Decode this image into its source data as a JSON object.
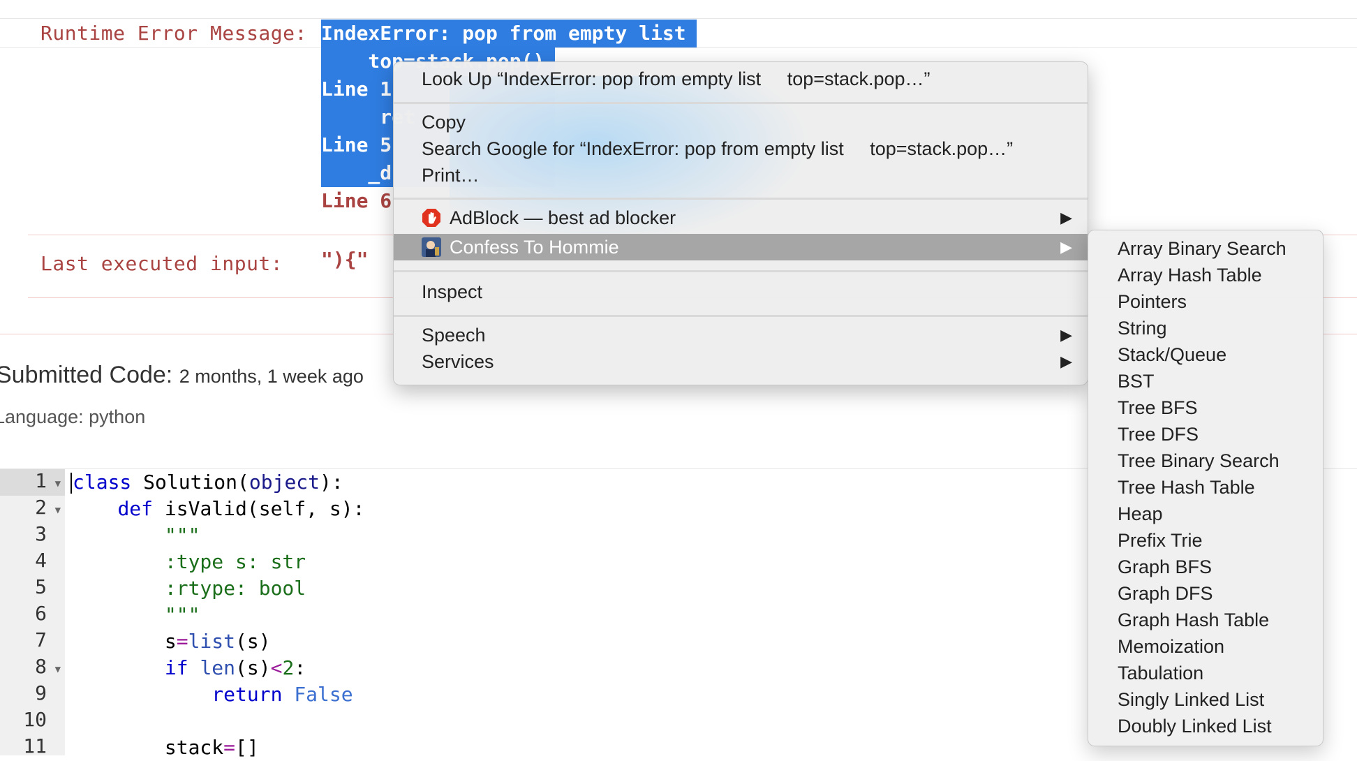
{
  "error": {
    "runtime_label": "Runtime Error Message:",
    "lines": [
      "IndexError: pop from empty list",
      "    top=stack.pop()",
      "Line 1",
      "     ret",
      "Line 5",
      "    _d",
      "Line 6"
    ],
    "last_input_label": "Last executed input:",
    "last_input_value": "\"){\""
  },
  "submission": {
    "title": "Submitted Code:",
    "when": "2 months, 1 week ago",
    "language_label": "Language:",
    "language": "python"
  },
  "code": {
    "line_numbers": [
      "1",
      "2",
      "3",
      "4",
      "5",
      "6",
      "7",
      "8",
      "9",
      "10",
      "11"
    ],
    "foldable": [
      true,
      true,
      false,
      false,
      false,
      false,
      false,
      true,
      false,
      false,
      false
    ]
  },
  "context_menu": {
    "look_up": "Look Up “IndexError: pop from empty list     top=stack.pop…”",
    "copy": "Copy",
    "search_google": "Search Google for “IndexError: pop from empty list     top=stack.pop…”",
    "print": "Print…",
    "adblock": "AdBlock — best ad blocker",
    "confess": "Confess To Hommie",
    "inspect": "Inspect",
    "speech": "Speech",
    "services": "Services",
    "arrow": "▶"
  },
  "submenu": {
    "items": [
      "Array Binary Search",
      "Array Hash Table",
      "Pointers",
      "String",
      "Stack/Queue",
      "BST",
      "Tree BFS",
      "Tree DFS",
      "Tree Binary Search",
      "Tree Hash Table",
      "Heap",
      "Prefix Trie",
      "Graph BFS",
      "Graph DFS",
      "Graph Hash Table",
      "Memoization",
      "Tabulation",
      "Singly Linked List",
      "Doubly Linked List"
    ]
  },
  "colors": {
    "selection": "#2f7de1",
    "error_text": "#a94442",
    "menu_highlight": "#a6a6a6"
  }
}
